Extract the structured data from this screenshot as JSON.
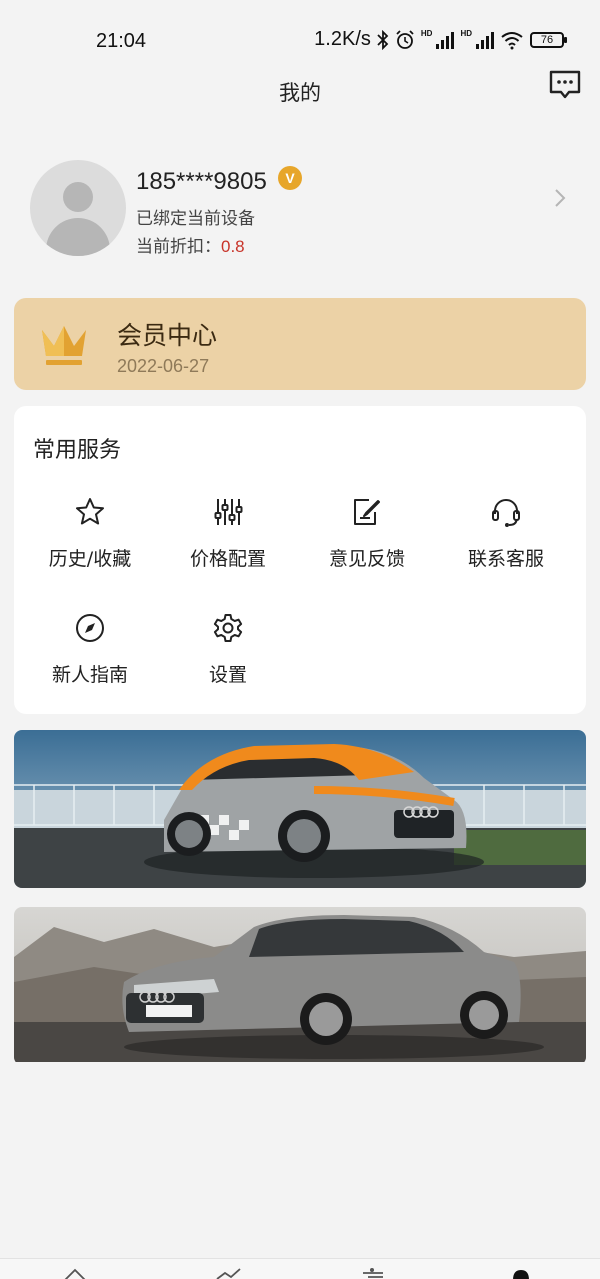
{
  "status_bar": {
    "time": "21:04",
    "network_speed": "1.2K/s",
    "hd1": "HD",
    "hd2": "HD",
    "battery": "76",
    "icons": [
      "bluetooth-icon",
      "alarm-icon",
      "signal-icon",
      "signal-icon",
      "wifi-icon",
      "battery-icon"
    ]
  },
  "header": {
    "title": "我的",
    "message_icon": "message-icon"
  },
  "profile": {
    "phone": "185****9805",
    "verified_mark": "V",
    "bound_text": "已绑定当前设备",
    "discount_label": "当前折扣：",
    "discount_value": "0.8"
  },
  "member": {
    "title": "会员中心",
    "date": "2022-06-27",
    "icon": "crown-icon"
  },
  "services": {
    "title": "常用服务",
    "items": [
      {
        "label": "历史/收藏",
        "icon": "star-icon"
      },
      {
        "label": "价格配置",
        "icon": "sliders-icon"
      },
      {
        "label": "意见反馈",
        "icon": "edit-icon"
      },
      {
        "label": "联系客服",
        "icon": "headset-icon"
      },
      {
        "label": "新人指南",
        "icon": "compass-icon"
      },
      {
        "label": "设置",
        "icon": "gear-icon"
      }
    ]
  },
  "banners": [
    {
      "alt": "banner-car-1"
    },
    {
      "alt": "banner-car-2"
    }
  ],
  "colors": {
    "accent_member": "#ecd2a6",
    "discount": "#c8342a",
    "verify": "#e7a62a",
    "background": "#f3f3f3"
  }
}
